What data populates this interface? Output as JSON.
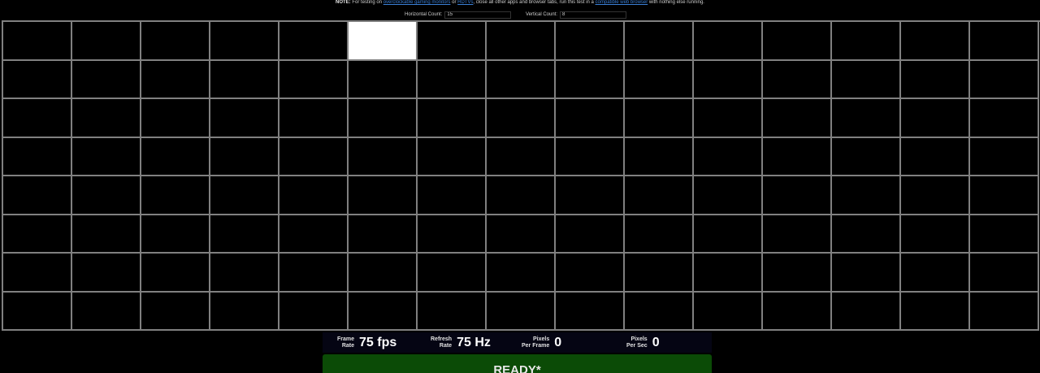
{
  "note": {
    "bold": "NOTE:",
    "text1": " For testing on ",
    "link1": "overclockable gaming monitors",
    "text2": " or ",
    "link2": "HDTVs",
    "text3": ", close all other apps and browser tabs, run this test in a ",
    "link3": "compatible web browser",
    "text4": " with nothing else running."
  },
  "controls": {
    "horizontal_label": "Horizontal Count:",
    "horizontal_value": "15",
    "vertical_label": "Vertical Count:",
    "vertical_value": "8"
  },
  "grid": {
    "columns": 15,
    "rows": 8,
    "lit_cell": {
      "row": 0,
      "col": 5
    }
  },
  "stats": {
    "frame_rate_label_1": "Frame",
    "frame_rate_label_2": "Rate",
    "frame_rate_value": "75 fps",
    "refresh_rate_label_1": "Refresh",
    "refresh_rate_label_2": "Rate",
    "refresh_rate_value": "75 Hz",
    "ppf_label_1": "Pixels",
    "ppf_label_2": "Per Frame",
    "ppf_value": "0",
    "pps_label_1": "Pixels",
    "pps_label_2": "Per Sec",
    "pps_value": "0"
  },
  "status": {
    "text": "READY*"
  },
  "colors": {
    "background": "#000000",
    "grid_line": "#808080",
    "lit_cell": "#ffffff",
    "status_bg": "#0b4b06",
    "link": "#3a7fd6"
  }
}
